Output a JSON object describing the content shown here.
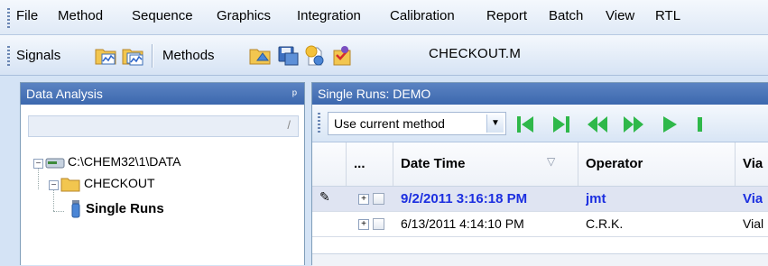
{
  "menu": [
    "File",
    "Method",
    "Sequence",
    "Graphics",
    "Integration",
    "Calibration",
    "Report",
    "Batch",
    "View",
    "RTL"
  ],
  "toolbar": {
    "signals_label": "Signals",
    "methods_label": "Methods",
    "method_file": "CHECKOUT.M",
    "icons": [
      "open-signal-icon",
      "open-signals-icon",
      "open-method-icon",
      "save-method-icon",
      "new-method-icon",
      "edit-method-icon"
    ]
  },
  "left_panel": {
    "title": "Data Analysis",
    "pin": "ᵖ",
    "filter_glyph": "/",
    "tree": {
      "root": "C:\\CHEM32\\1\\DATA",
      "folder": "CHECKOUT",
      "leaf": "Single Runs"
    }
  },
  "right_panel": {
    "title": "Single Runs: DEMO",
    "method_combo": "Use current method",
    "nav_buttons": [
      "first-icon",
      "last-icon",
      "previous-icon",
      "next-icon",
      "play-icon"
    ],
    "columns": [
      "...",
      "Date Time",
      "Operator",
      "Via"
    ],
    "rows": [
      {
        "datetime": "9/2/2011 3:16:18 PM",
        "operator": "jmt",
        "vial": "Via",
        "selected": true
      },
      {
        "datetime": "6/13/2011 4:14:10 PM",
        "operator": "C.R.K.",
        "vial": "Vial",
        "selected": false
      }
    ]
  },
  "colors": {
    "panel_title": "#3c68ae",
    "selected_text": "#1c2fe0",
    "nav_green": "#2fb84a"
  }
}
